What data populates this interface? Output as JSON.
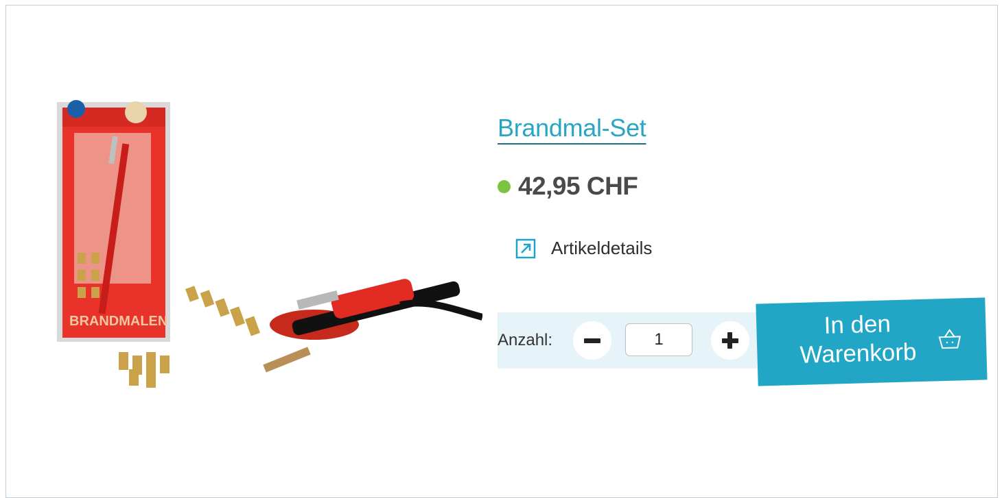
{
  "product": {
    "title": "Brandmal-Set",
    "price": "42,95 CHF",
    "image_alt": "Brandmal-Set mit Lötkolben und Brennspitzen",
    "box_label": "BRANDMALEN"
  },
  "stock_indicator_color": "#7dc242",
  "details_link": {
    "label": "Artikeldetails",
    "icon": "external-link-icon"
  },
  "quantity": {
    "label": "Anzahl:",
    "value": "1",
    "decrement_icon": "minus-icon",
    "increment_icon": "plus-icon"
  },
  "cart_button": {
    "label": "In den\nWarenkorb",
    "icon": "basket-icon"
  },
  "colors": {
    "accent": "#22a6c6",
    "title": "#27a5c2",
    "panel": "#e6f4f9"
  }
}
